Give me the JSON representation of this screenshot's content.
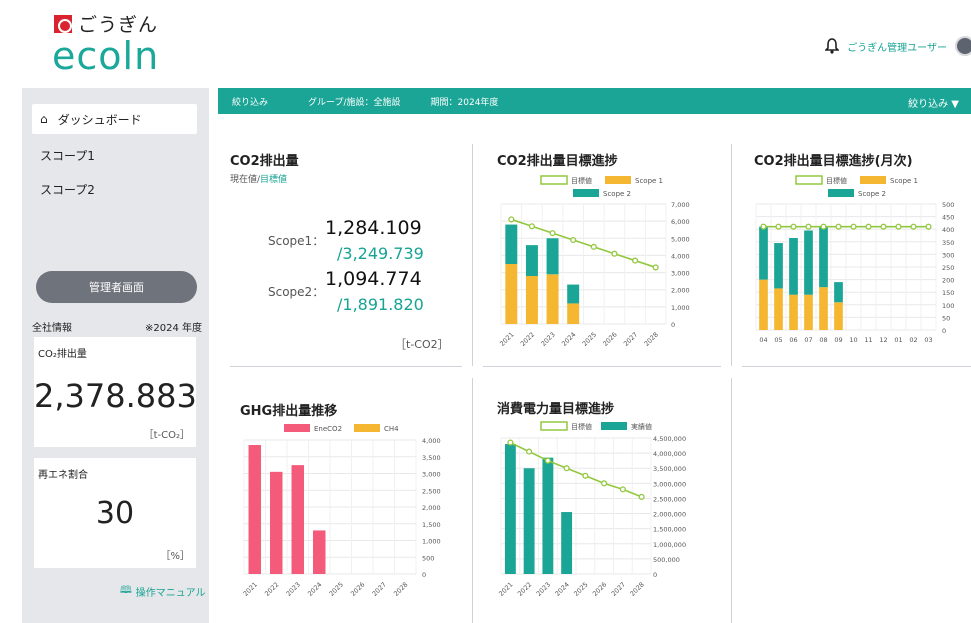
{
  "header": {
    "brand_jp": "ごうぎん",
    "brand_main": "ecoln",
    "user_name": "ごうぎん管理ユーザー"
  },
  "sidebar": {
    "items": [
      {
        "label": "ダッシュボード",
        "icon": "home-icon",
        "active": true
      },
      {
        "label": "スコープ1"
      },
      {
        "label": "スコープ2"
      }
    ],
    "admin_button": "管理者画面",
    "corp_info_label": "全社情報",
    "corp_info_year": "※2024 年度",
    "co2_card": {
      "label": "CO₂排出量",
      "value": "2,378.883",
      "unit": "［t-CO₂］"
    },
    "re_card": {
      "label": "再エネ割合",
      "value": "30",
      "unit": "［%］"
    },
    "manual_link": "操作マニュアル"
  },
  "filter_bar": {
    "label": "絞り込み",
    "group": "グループ/施設：全施設",
    "period": "期間：2024年度",
    "toggle": "絞り込み ▼"
  },
  "panels": {
    "co2_emission": {
      "title": "CO2排出量",
      "subtitle_current": "現在値/",
      "subtitle_target": "目標値",
      "scope1_label": "Scope1：",
      "scope1_value": "1,284.109",
      "scope1_target": "/3,249.739",
      "scope2_label": "Scope2：",
      "scope2_value": "1,094.774",
      "scope2_target": "/1,891.820",
      "unit": "［t-CO2］"
    },
    "co2_progress": {
      "title": "CO2排出量目標進捗"
    },
    "co2_monthly": {
      "title": "CO2排出量目標進捗(月次)"
    },
    "ghg_trend": {
      "title": "GHG排出量推移"
    },
    "power_progress": {
      "title": "消費電力量目標進捗"
    }
  },
  "colors": {
    "teal": "#1aa596",
    "orange": "#f5b731",
    "green_line": "#93c83e",
    "pink": "#f45a7a",
    "sidebar_bg": "#e6e7ea"
  },
  "chart_data": [
    {
      "type": "bar",
      "title": "CO2排出量目標進捗",
      "categories": [
        "2021",
        "2022",
        "2023",
        "2024",
        "2025",
        "2026",
        "2027",
        "2028"
      ],
      "series": [
        {
          "name": "Scope 1",
          "values": [
            3500,
            2800,
            2900,
            1200,
            0,
            0,
            0,
            0
          ]
        },
        {
          "name": "Scope 2",
          "values": [
            2300,
            1800,
            2100,
            1100,
            0,
            0,
            0,
            0
          ]
        },
        {
          "name": "目標値",
          "values": [
            6100,
            5700,
            5300,
            4900,
            4500,
            4100,
            3700,
            3300
          ]
        }
      ],
      "ylim": [
        0,
        7000
      ],
      "yticks": [
        "0",
        "1,000",
        "2,000",
        "3,000",
        "4,000",
        "5,000",
        "6,000",
        "7,000"
      ]
    },
    {
      "type": "bar",
      "title": "CO2排出量目標進捗(月次)",
      "categories": [
        "04",
        "05",
        "06",
        "07",
        "08",
        "09",
        "10",
        "11",
        "12",
        "01",
        "02",
        "03"
      ],
      "series": [
        {
          "name": "Scope 1",
          "values": [
            200,
            165,
            140,
            140,
            170,
            110,
            0,
            0,
            0,
            0,
            0,
            0
          ]
        },
        {
          "name": "Scope 2",
          "values": [
            210,
            180,
            225,
            255,
            240,
            80,
            0,
            0,
            0,
            0,
            0,
            0
          ]
        },
        {
          "name": "目標値",
          "values": [
            410,
            410,
            410,
            410,
            410,
            410,
            410,
            410,
            410,
            410,
            410,
            410
          ]
        }
      ],
      "ylim": [
        0,
        500
      ],
      "yticks": [
        "0",
        "50",
        "100",
        "150",
        "200",
        "250",
        "300",
        "350",
        "400",
        "450",
        "500"
      ]
    },
    {
      "type": "bar",
      "title": "GHG排出量推移",
      "categories": [
        "2021",
        "2022",
        "2023",
        "2024",
        "2025",
        "2026",
        "2027",
        "2028"
      ],
      "series": [
        {
          "name": "EneCO2",
          "values": [
            3850,
            3050,
            3250,
            1300,
            0,
            0,
            0,
            0
          ]
        },
        {
          "name": "CH4",
          "values": [
            0,
            0,
            0,
            0,
            0,
            0,
            0,
            0
          ]
        }
      ],
      "ylim": [
        0,
        4000
      ],
      "yticks": [
        "0",
        "500",
        "1,000",
        "1,500",
        "2,000",
        "2,500",
        "3,000",
        "3,500",
        "4,000"
      ]
    },
    {
      "type": "bar",
      "title": "消費電力量目標進捗",
      "categories": [
        "2021",
        "2022",
        "2023",
        "2024",
        "2025",
        "2026",
        "2027",
        "2028"
      ],
      "series": [
        {
          "name": "実績値",
          "values": [
            4300000,
            3500000,
            3850000,
            2050000,
            0,
            0,
            0,
            0
          ]
        },
        {
          "name": "目標値",
          "values": [
            4350000,
            4050000,
            3750000,
            3500000,
            3250000,
            3000000,
            2800000,
            2550000
          ]
        }
      ],
      "ylim": [
        0,
        4500000
      ],
      "yticks": [
        "0",
        "500,000",
        "1,000,000",
        "1,500,000",
        "2,000,000",
        "2,500,000",
        "3,000,000",
        "3,500,000",
        "4,000,000",
        "4,500,000"
      ]
    }
  ]
}
